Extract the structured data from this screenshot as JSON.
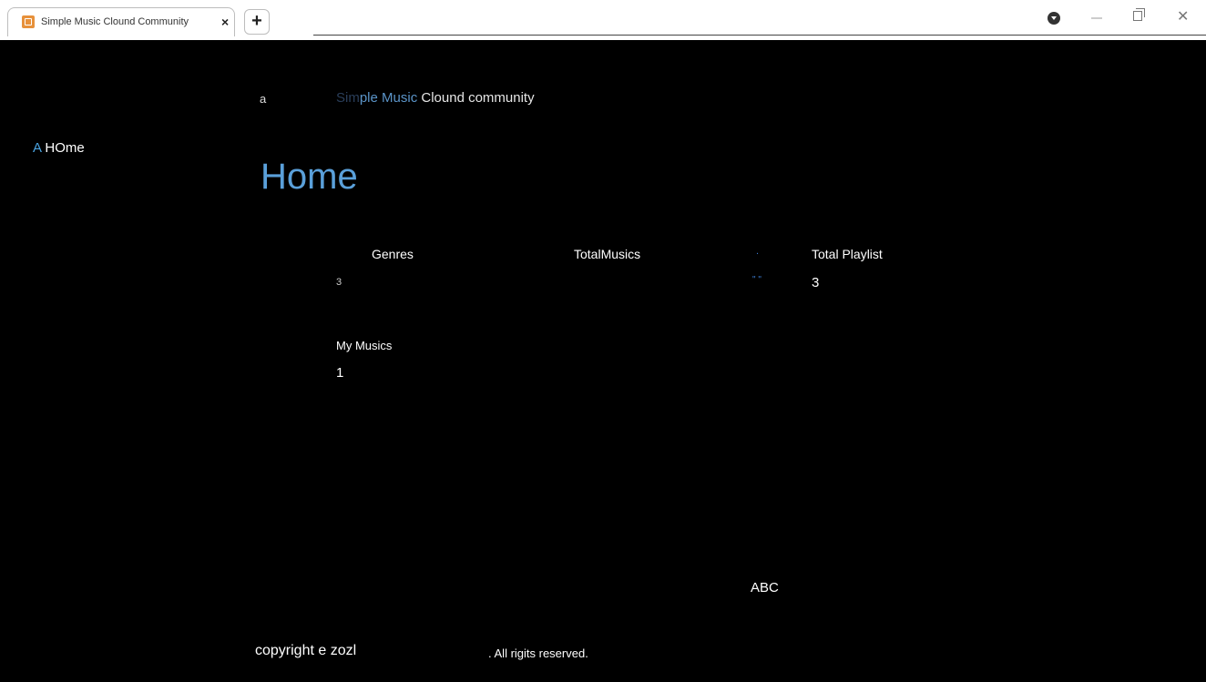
{
  "browser": {
    "tab_title": "Simple Music Clound Community",
    "tab_close": "×",
    "new_tab": "+",
    "window_close": "✕"
  },
  "sidebar": {
    "home_prefix": "A",
    "home_label": "HOme"
  },
  "header": {
    "brand_letter": "a",
    "brand_part1": "Sim",
    "brand_part2": "ple Music",
    "brand_part3": " Clound community"
  },
  "main": {
    "title": "Home",
    "stats": {
      "genres_label": "Genres",
      "genres_value": "3",
      "total_musics_label": "TotalMusics",
      "total_playlist_dot": ".",
      "total_playlist_marks": "\" \"",
      "total_playlist_label": "Total Playlist",
      "total_playlist_value": "3",
      "my_musics_label": "My Musics",
      "my_musics_value": "1"
    },
    "abc_text": "ABC"
  },
  "footer": {
    "copyright": "copyright e zozl",
    "rights": ". All rigits reserved."
  },
  "colors": {
    "background": "#000000",
    "title_blue": "#5aa0da",
    "link_blue": "#4aa3e0"
  }
}
